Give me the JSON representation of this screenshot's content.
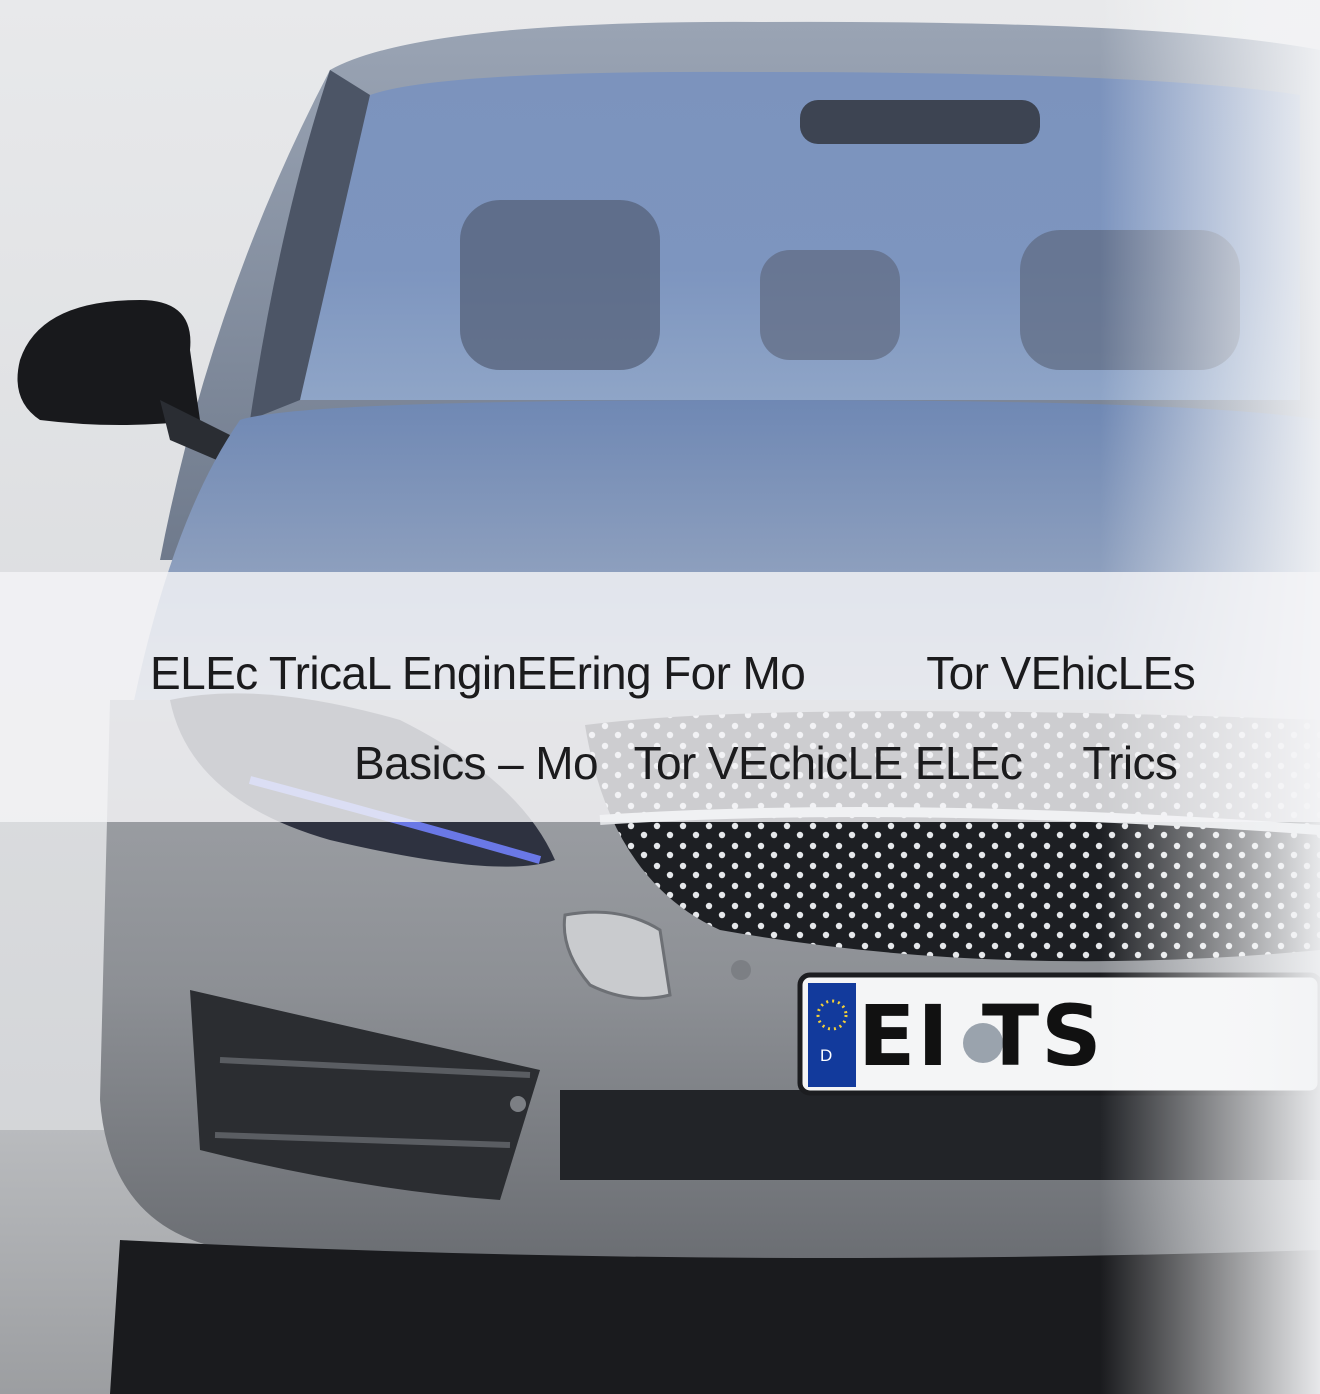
{
  "cover": {
    "title": "ELEc TricaL EnginEEring For Mo          Tor VEhicLEs",
    "subtitle": "Basics – Mo   Tor VEchicLE ELEc     Trics"
  },
  "photo": {
    "subject": "car-front-photo",
    "plate": {
      "country": "D",
      "text": "EI TS"
    }
  },
  "colors": {
    "car_body": "#8a8f97",
    "windshield": "#6e86b0",
    "band": "#f4f4f6",
    "text": "#1b1b1d"
  }
}
